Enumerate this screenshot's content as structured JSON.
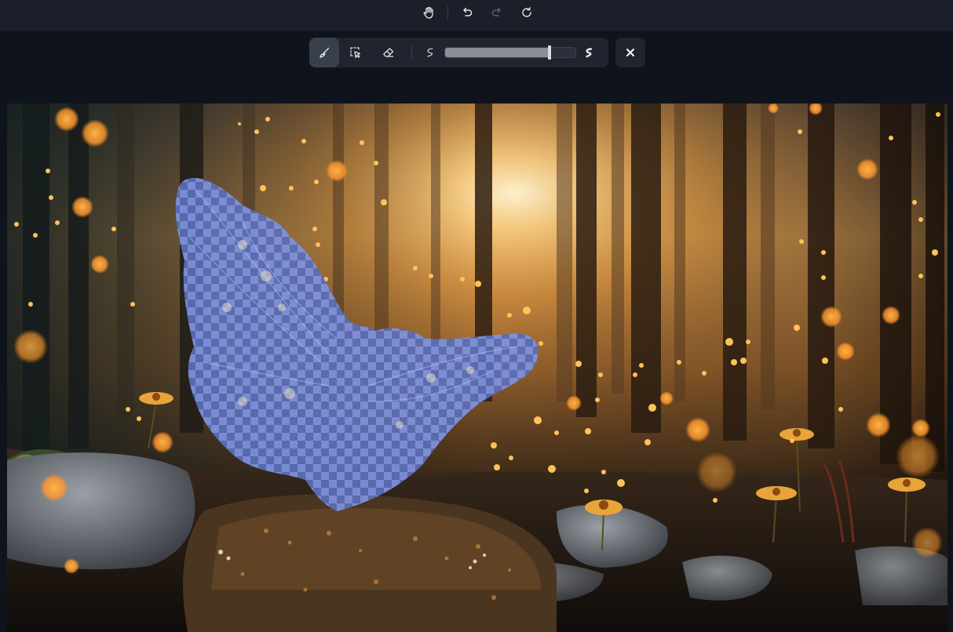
{
  "top_toolbar": {
    "items": [
      {
        "name": "pan-tool",
        "icon": "hand-icon"
      },
      {
        "name": "undo",
        "icon": "undo-icon"
      },
      {
        "name": "redo",
        "icon": "redo-icon",
        "disabled": true
      },
      {
        "name": "reset",
        "icon": "refresh-icon"
      }
    ]
  },
  "mask_toolbar": {
    "tools": [
      {
        "name": "brush",
        "icon": "brush-icon",
        "active": true
      },
      {
        "name": "smart-select",
        "icon": "smart-select-icon",
        "active": false
      },
      {
        "name": "eraser",
        "icon": "eraser-icon",
        "active": false
      }
    ],
    "brush_size": {
      "min_icon": "thin-stroke-icon",
      "max_icon": "thick-stroke-icon",
      "value_percent": 80
    },
    "close_icon": "close-icon"
  },
  "canvas": {
    "image_subject": "forest-sunset-with-fireflies",
    "mask_subject": "butterfly",
    "mask_color": "#6b7fd8"
  },
  "colors": {
    "app_bg": "#0f141c",
    "toolbar_bg": "#1f242e",
    "active_tool_bg": "#3a404b",
    "icon_color": "#e6e8ec",
    "disabled_icon_color": "#5b616c"
  }
}
